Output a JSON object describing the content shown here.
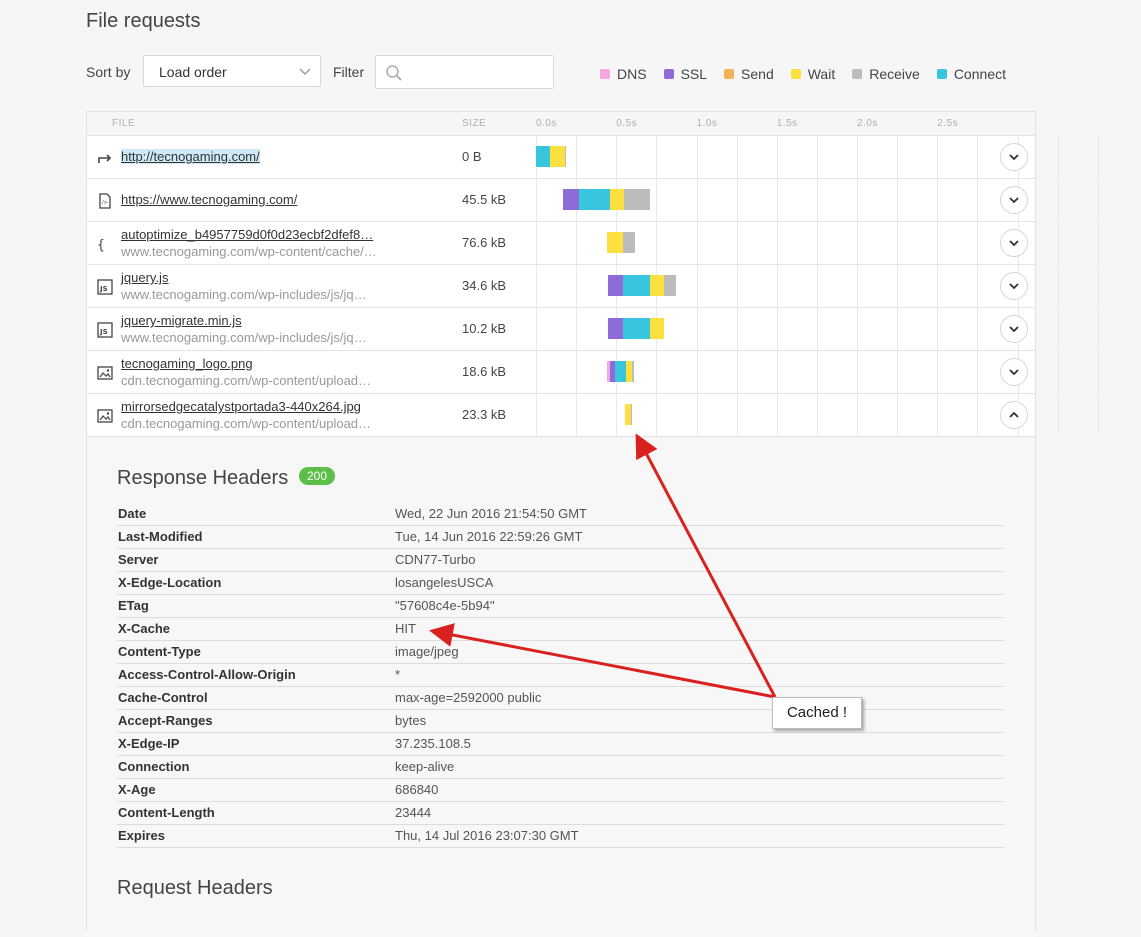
{
  "page_title": "File requests",
  "toolbar": {
    "sort_label": "Sort by",
    "sort_value": "Load order",
    "filter_label": "Filter",
    "filter_value": ""
  },
  "legend": [
    {
      "label": "DNS",
      "color": "#f4a6e0"
    },
    {
      "label": "SSL",
      "color": "#8e6bd6"
    },
    {
      "label": "Send",
      "color": "#f3b15b"
    },
    {
      "label": "Wait",
      "color": "#fbe03f"
    },
    {
      "label": "Receive",
      "color": "#bcbcbc"
    },
    {
      "label": "Connect",
      "color": "#38c6de"
    }
  ],
  "table": {
    "headers": {
      "file": "FILE",
      "size": "SIZE"
    },
    "ticks": [
      "0.0s",
      "0.5s",
      "1.0s",
      "1.5s",
      "2.0s",
      "2.5s"
    ],
    "rows": [
      {
        "icon": "redirect-icon",
        "name": "http://tecnogaming.com/",
        "url": "",
        "size": "0 B",
        "expanded": false,
        "timing": [
          {
            "phase": "Connect",
            "start": 0.0,
            "end": 0.09
          },
          {
            "phase": "Wait",
            "start": 0.09,
            "end": 0.18
          },
          {
            "phase": "Receive",
            "start": 0.18,
            "end": 0.185
          }
        ]
      },
      {
        "icon": "html-file-icon",
        "name": "https://www.tecnogaming.com/",
        "url": "",
        "size": "45.5 kB",
        "expanded": false,
        "timing": [
          {
            "phase": "SSL",
            "start": 0.17,
            "end": 0.27
          },
          {
            "phase": "Connect",
            "start": 0.27,
            "end": 0.46
          },
          {
            "phase": "Wait",
            "start": 0.46,
            "end": 0.55
          },
          {
            "phase": "Receive",
            "start": 0.55,
            "end": 0.71
          }
        ]
      },
      {
        "icon": "css-file-icon",
        "name": "autoptimize_b4957759d0f0d23ecbf2dfef8…",
        "url": "www.tecnogaming.com/wp-content/cache/…",
        "size": "76.6 kB",
        "expanded": false,
        "timing": [
          {
            "phase": "Wait",
            "start": 0.44,
            "end": 0.54
          },
          {
            "phase": "Receive",
            "start": 0.54,
            "end": 0.62
          }
        ]
      },
      {
        "icon": "js-file-icon",
        "name": "jquery.js",
        "url": "www.tecnogaming.com/wp-includes/js/jq…",
        "size": "34.6 kB",
        "expanded": false,
        "timing": [
          {
            "phase": "SSL",
            "start": 0.45,
            "end": 0.54
          },
          {
            "phase": "Connect",
            "start": 0.54,
            "end": 0.71
          },
          {
            "phase": "Wait",
            "start": 0.71,
            "end": 0.8
          },
          {
            "phase": "Receive",
            "start": 0.8,
            "end": 0.87
          }
        ]
      },
      {
        "icon": "js-file-icon",
        "name": "jquery-migrate.min.js",
        "url": "www.tecnogaming.com/wp-includes/js/jq…",
        "size": "10.2 kB",
        "expanded": false,
        "timing": [
          {
            "phase": "SSL",
            "start": 0.45,
            "end": 0.54
          },
          {
            "phase": "Connect",
            "start": 0.54,
            "end": 0.71
          },
          {
            "phase": "Wait",
            "start": 0.71,
            "end": 0.8
          }
        ]
      },
      {
        "icon": "image-file-icon",
        "name": "tecnogaming_logo.png",
        "url": "cdn.tecnogaming.com/wp-content/upload…",
        "size": "18.6 kB",
        "expanded": false,
        "timing": [
          {
            "phase": "DNS",
            "start": 0.445,
            "end": 0.46
          },
          {
            "phase": "SSL",
            "start": 0.46,
            "end": 0.49
          },
          {
            "phase": "Connect",
            "start": 0.49,
            "end": 0.56
          },
          {
            "phase": "Wait",
            "start": 0.56,
            "end": 0.6
          },
          {
            "phase": "Receive",
            "start": 0.6,
            "end": 0.61
          }
        ]
      },
      {
        "icon": "image-file-icon",
        "name": "mirrorsedgecatalystportada3-440x264.jpg",
        "url": "cdn.tecnogaming.com/wp-content/upload…",
        "size": "23.3 kB",
        "expanded": true,
        "timing": [
          {
            "phase": "Wait",
            "start": 0.555,
            "end": 0.59
          },
          {
            "phase": "Receive",
            "start": 0.59,
            "end": 0.6
          }
        ]
      }
    ]
  },
  "response_headers": {
    "title": "Response Headers",
    "status": "200",
    "rows": [
      {
        "key": "Date",
        "value": "Wed, 22 Jun 2016 21:54:50 GMT"
      },
      {
        "key": "Last-Modified",
        "value": "Tue, 14 Jun 2016 22:59:26 GMT"
      },
      {
        "key": "Server",
        "value": "CDN77-Turbo"
      },
      {
        "key": "X-Edge-Location",
        "value": "losangelesUSCA"
      },
      {
        "key": "ETag",
        "value": "\"57608c4e-5b94\""
      },
      {
        "key": "X-Cache",
        "value": "HIT"
      },
      {
        "key": "Content-Type",
        "value": "image/jpeg"
      },
      {
        "key": "Access-Control-Allow-Origin",
        "value": "*"
      },
      {
        "key": "Cache-Control",
        "value": "max-age=2592000 public"
      },
      {
        "key": "Accept-Ranges",
        "value": "bytes"
      },
      {
        "key": "X-Edge-IP",
        "value": "37.235.108.5"
      },
      {
        "key": "Connection",
        "value": "keep-alive"
      },
      {
        "key": "X-Age",
        "value": "686840"
      },
      {
        "key": "Content-Length",
        "value": "23444"
      },
      {
        "key": "Expires",
        "value": "Thu, 14 Jul 2016 23:07:30 GMT"
      }
    ]
  },
  "request_headers_title": "Request Headers",
  "annotation": {
    "text": "Cached !",
    "arrow_color": "#d9221f"
  }
}
